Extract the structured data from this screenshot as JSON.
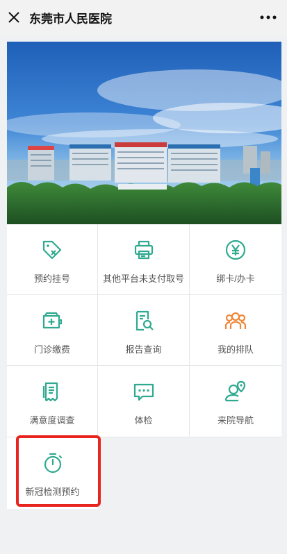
{
  "header": {
    "title": "东莞市人民医院",
    "close_icon": "close-icon",
    "more_icon": "more-icon"
  },
  "banner": {
    "alt": "hospital-building-photo"
  },
  "menu": {
    "items": [
      {
        "label": "预约挂号",
        "icon": "tag-x-icon"
      },
      {
        "label": "其他平台未支付取号",
        "icon": "printer-icon"
      },
      {
        "label": "绑卡/办卡",
        "icon": "yen-circle-icon"
      },
      {
        "label": "门诊缴费",
        "icon": "wallet-plus-icon"
      },
      {
        "label": "报告查询",
        "icon": "report-search-icon"
      },
      {
        "label": "我的排队",
        "icon": "queue-people-icon"
      },
      {
        "label": "满意度调查",
        "icon": "survey-icon"
      },
      {
        "label": "体检",
        "icon": "message-dots-icon"
      },
      {
        "label": "来院导航",
        "icon": "user-location-icon"
      }
    ],
    "extra": {
      "label": "新冠检测预约",
      "icon": "stopwatch-icon"
    }
  },
  "colors": {
    "accent": "#2fa98f",
    "orange": "#f0873a",
    "highlight": "#e8241f"
  }
}
